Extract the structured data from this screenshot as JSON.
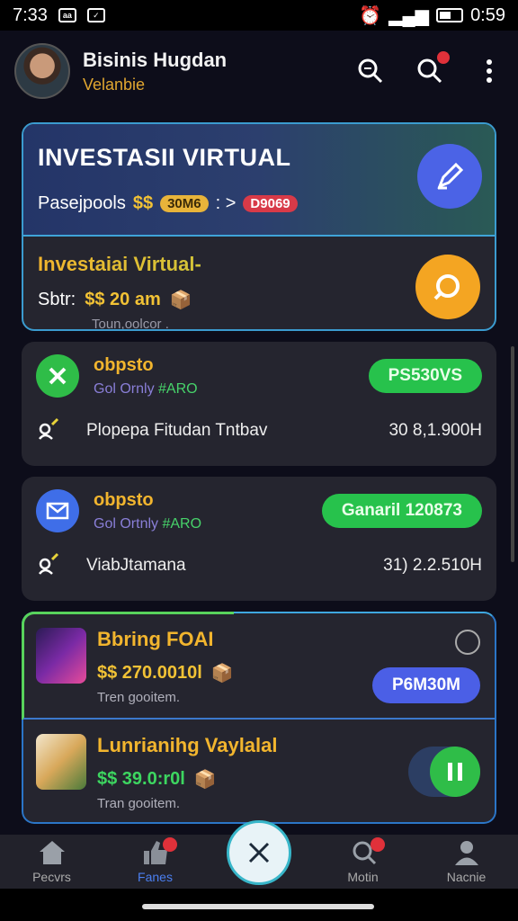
{
  "status_bar": {
    "time": "7:33",
    "battery": "0:59",
    "icon_a": "aa"
  },
  "header": {
    "title": "Bisinis Hugdan",
    "subtitle": "Velanbie"
  },
  "hero": {
    "title": "INVESTASII VIRTUAL",
    "row_label": "Pasejpools",
    "currency": "$$",
    "pill1": "30M6",
    "arrow": ": >",
    "pill2": "D9069"
  },
  "hero_bottom": {
    "title": "Investaiai Virtual-",
    "label": "Sbtr:",
    "amount": "$$ 20 am",
    "sub": "Toun,oolcor ."
  },
  "transactions": [
    {
      "name": "obpsto",
      "meta_a": "Gol Ornly",
      "meta_b": "#ARO",
      "button": "PS530VS",
      "label": "Plopepa Fitudan Tntbav",
      "value": "30 8,1.900H"
    },
    {
      "name": "obpsto",
      "meta_a": "Gol Ortnly",
      "meta_b": "#ARO",
      "button": "Ganaril 120873",
      "label": "ViabJtamana",
      "value": "31) 2.2.510H"
    }
  ],
  "promos": [
    {
      "title": "Bbring FOAI",
      "amount": "$$ 270.0010l",
      "sub": "Tren gooitem.",
      "button": "P6M30M"
    },
    {
      "title": "Lunrianihg Vaylalal",
      "amount": "$$ 39.0:r0l",
      "sub": "Tran gooitem."
    }
  ],
  "nav": [
    {
      "label": "Pecvrs"
    },
    {
      "label": "Fanes"
    },
    {
      "label": "Motin"
    },
    {
      "label": "Nacnie"
    }
  ],
  "colors": {
    "accent_blue": "#4b63e6",
    "accent_green": "#27c24c",
    "accent_orange": "#f4a522",
    "gold": "#f2b52e"
  }
}
